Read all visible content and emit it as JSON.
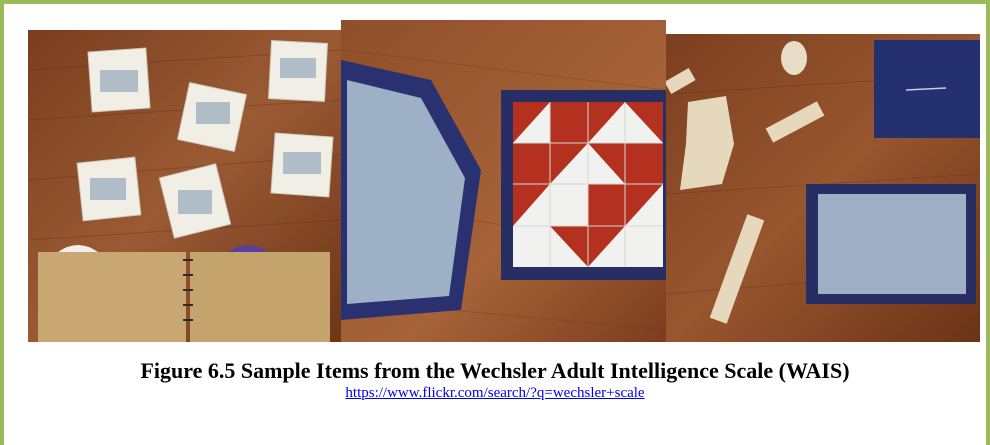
{
  "figure": {
    "caption": "Figure 6.5 Sample Items from the Wechsler Adult Intelligence Scale (WAIS)",
    "link": "https://www.flickr.com/search/?q=wechsler+scale"
  },
  "photos": [
    {
      "icon": "picture-completion-cards-photo"
    },
    {
      "icon": "block-design-photo"
    },
    {
      "icon": "object-assembly-photo"
    }
  ],
  "colors": {
    "frame_border": "#9bbb59",
    "wood": "#8a4a26",
    "block_red": "#b3311e",
    "box_blue": "#2a3170",
    "link": "#0000ee"
  }
}
